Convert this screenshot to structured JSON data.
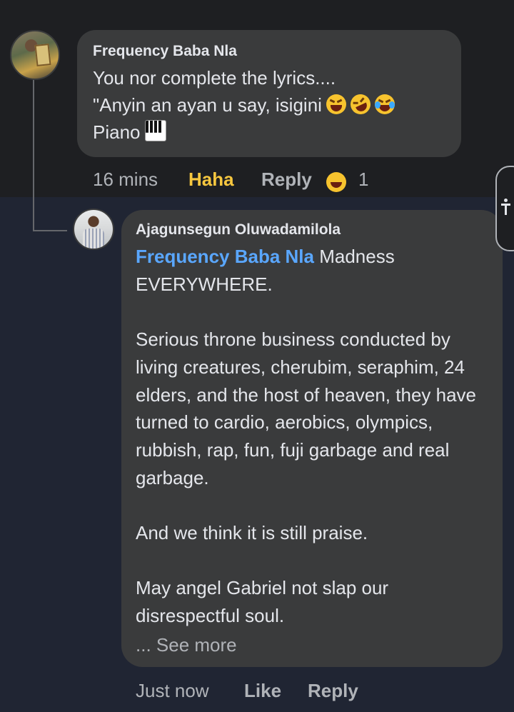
{
  "comment1": {
    "author": "Frequency Baba Nla",
    "text_line1": "You nor complete the lyrics....",
    "text_line2": "\"Anyin an ayan u say, isigini",
    "text_line3": "Piano",
    "time": "16 mins",
    "reaction_label": "Haha",
    "reply_label": "Reply",
    "reaction_count": "1"
  },
  "comment2": {
    "author": "Ajagunsegun Oluwadamilola",
    "mention": "Frequency Baba Nla",
    "text_first": " Madness EVERYWHERE.",
    "paragraph2": "Serious throne business conducted by living creatures, cherubim, seraphim, 24 elders, and the host of heaven, they have turned to cardio, aerobics, olympics, rubbish, rap, fun, fuji garbage and real garbage.",
    "paragraph3": "And we think it is still praise.",
    "paragraph4": "May angel Gabriel not slap our disrespectful soul.",
    "see_more": "... See more",
    "time": "Just now",
    "like_label": "Like",
    "reply_label": "Reply"
  },
  "colors": {
    "background_top": "#1e1f22",
    "background_bottom": "#202533",
    "bubble": "#3a3b3c",
    "mention": "#5aa7ff",
    "haha": "#f7c73f",
    "meta": "#b0b3b8"
  },
  "icons": [
    "grinning-squinting-emoji-icon",
    "rofl-emoji-icon",
    "tears-of-joy-emoji-icon",
    "piano-icon",
    "haha-reaction-icon",
    "accessibility-icon"
  ]
}
